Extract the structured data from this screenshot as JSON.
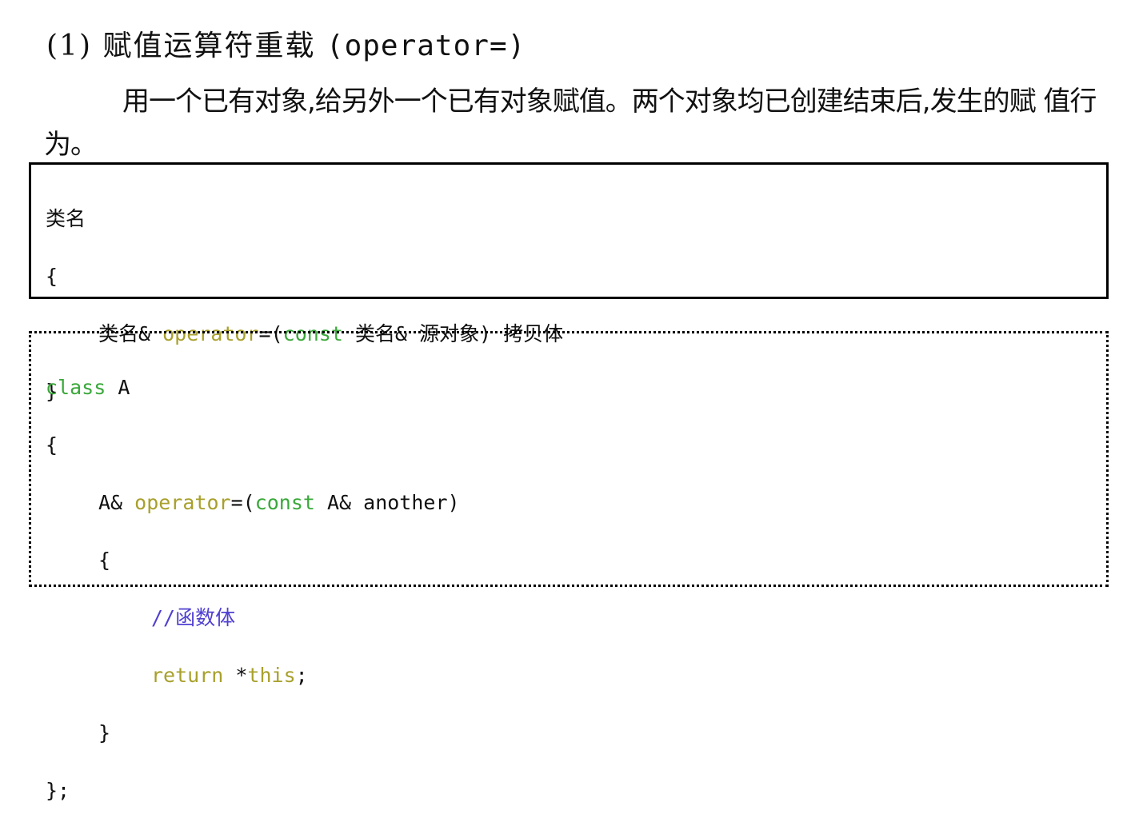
{
  "heading": {
    "number": "(1)",
    "title": " 赋值运算符重载 ",
    "code": "(operator=)"
  },
  "paragraph": "用一个已有对象,给另外一个已有对象赋值。两个对象均已创建结束后,发生的赋 值行为。",
  "syntax_box": {
    "line1": "类名",
    "line2": "{",
    "line3_a": "类名& ",
    "line3_op": "operator",
    "line3_b": "=(",
    "line3_const": "const",
    "line3_c": " 类名& 源对象) 拷贝体",
    "line4": "}"
  },
  "example_box": {
    "l1_class": "class",
    "l1_name": " A",
    "l2": "{",
    "l3_a": "A& ",
    "l3_op": "operator",
    "l3_b": "=(",
    "l3_const": "const",
    "l3_c": " A& another)",
    "l4": "{",
    "l5_comment": "//函数体",
    "l6_return": "return",
    "l6_star": " *",
    "l6_this": "this",
    "l6_semi": ";",
    "l7": "}",
    "l8": "};"
  },
  "colors": {
    "keyword_green": "#3aa83a",
    "keyword_olive": "#a8a02c",
    "comment_purple": "#5040d0"
  }
}
